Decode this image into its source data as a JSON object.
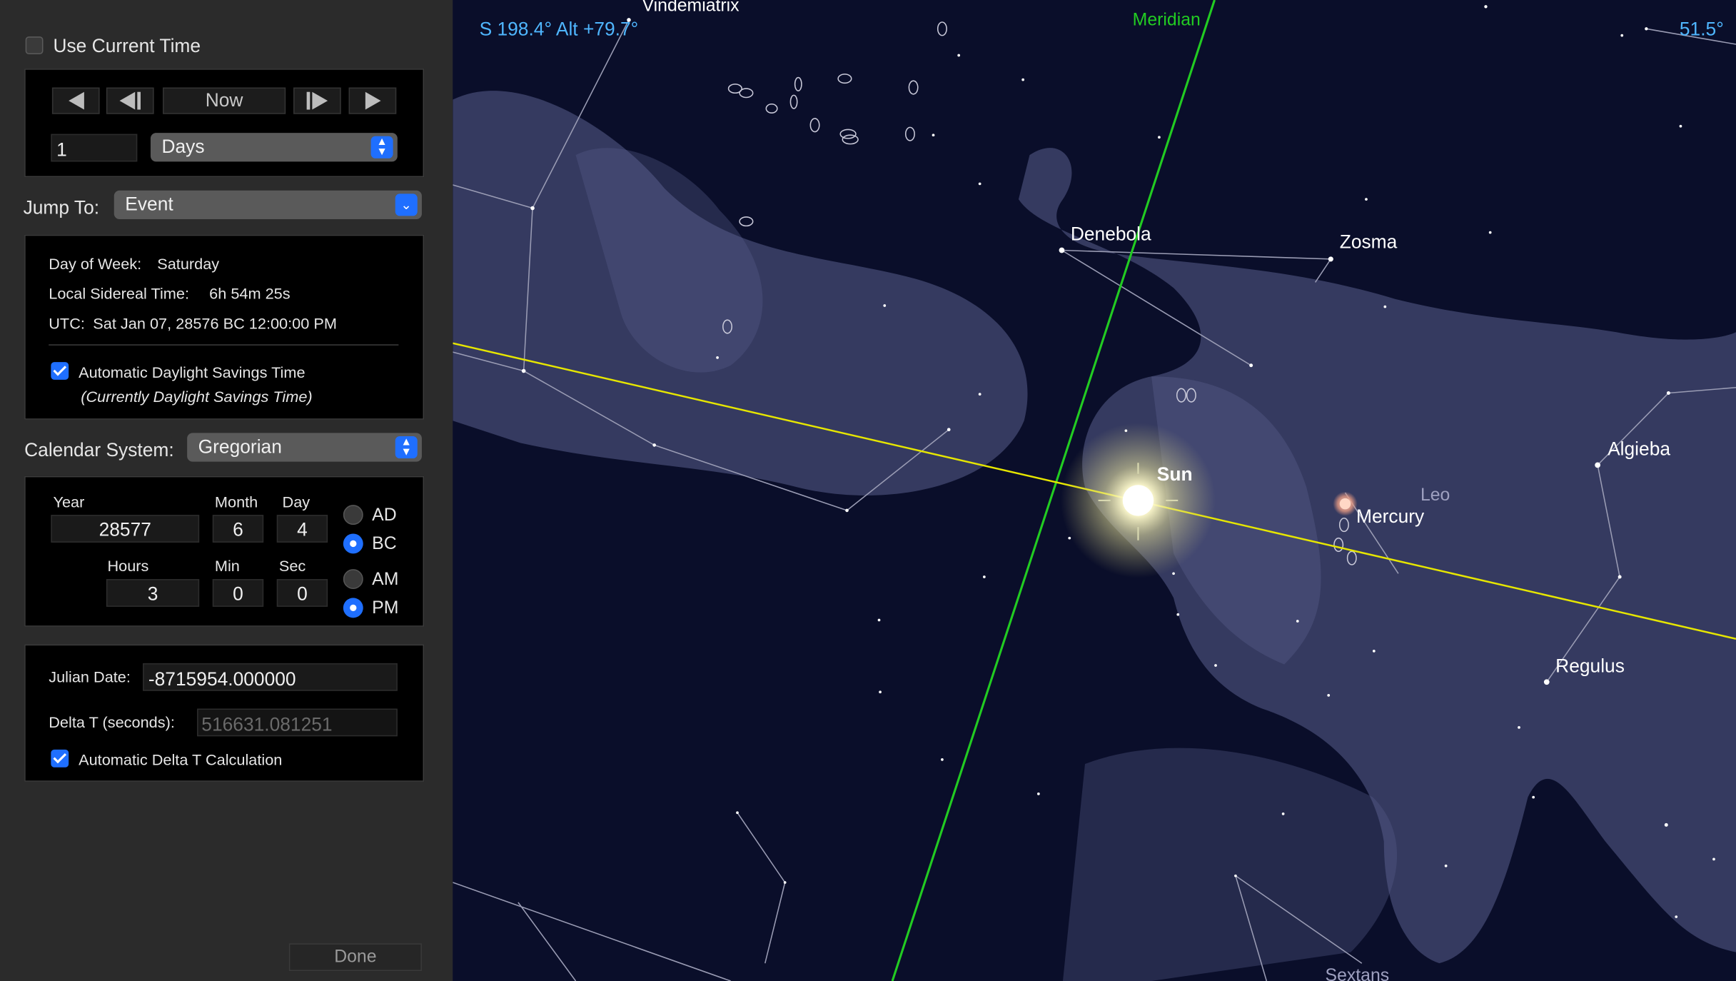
{
  "time_panel": {
    "use_current_time_label": "Use Current Time",
    "now_label": "Now",
    "step_value": "1",
    "step_unit": "Days",
    "jump_to_label": "Jump To:",
    "jump_to_value": "Event",
    "day_of_week_label": "Day of Week:",
    "day_of_week": "Saturday",
    "sidereal_label": "Local Sidereal Time:",
    "sidereal_value": "6h 54m 25s",
    "utc_label": "UTC:",
    "utc_value": "Sat Jan 07, 28576 BC 12:00:00 PM",
    "dst_label": "Automatic Daylight Savings Time",
    "dst_note": "(Currently Daylight Savings Time)",
    "calendar_label": "Calendar System:",
    "calendar_value": "Gregorian",
    "year_label": "Year",
    "month_label": "Month",
    "day_label": "Day",
    "hours_label": "Hours",
    "min_label": "Min",
    "sec_label": "Sec",
    "year": "28577",
    "month": "6",
    "day": "4",
    "hours": "3",
    "min": "0",
    "sec": "0",
    "ad_label": "AD",
    "bc_label": "BC",
    "am_label": "AM",
    "pm_label": "PM",
    "julian_label": "Julian Date:",
    "julian_value": "-8715954.000000",
    "delta_t_label": "Delta T (seconds):",
    "delta_t_value": "516631.081251",
    "auto_delta_label": "Automatic Delta T Calculation",
    "done_label": "Done"
  },
  "sky": {
    "coords": "S 198.4° Alt +79.7°",
    "fov": "51.5°",
    "meridian_label": "Meridian",
    "labels": {
      "vindemiatrix": "Vindemiatrix",
      "denebola": "Denebola",
      "zosma": "Zosma",
      "sun": "Sun",
      "mercury": "Mercury",
      "leo": "Leo",
      "algieba": "Algieba",
      "regulus": "Regulus",
      "sextans": "Sextans"
    },
    "colors": {
      "coords": "#4fb6ff",
      "meridian": "#22cc22",
      "ecliptic": "#e6e600",
      "background": "#0a0e2a"
    }
  }
}
